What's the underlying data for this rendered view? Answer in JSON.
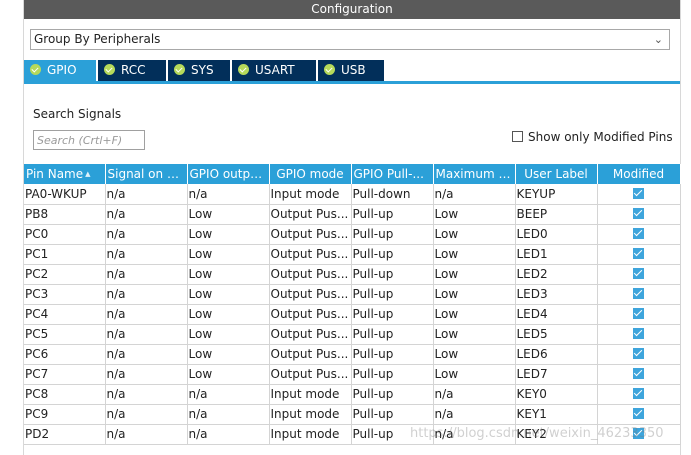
{
  "window": {
    "title": "Configuration"
  },
  "grouping": {
    "selected": "Group By Peripherals"
  },
  "tabs": [
    {
      "label": "GPIO",
      "icon": "ok-check-icon",
      "active": true
    },
    {
      "label": "RCC",
      "icon": "ok-check-icon",
      "active": false
    },
    {
      "label": "SYS",
      "icon": "ok-check-icon",
      "active": false
    },
    {
      "label": "USART",
      "icon": "ok-check-icon",
      "active": false
    },
    {
      "label": "USB",
      "icon": "ok-check-icon",
      "active": false
    }
  ],
  "search": {
    "label": "Search Signals",
    "placeholder": "Search (Crtl+F)",
    "value": ""
  },
  "filter": {
    "label": "Show only Modified Pins",
    "checked": false
  },
  "table": {
    "columns": [
      "Pin Name",
      "Signal on Pin",
      "GPIO outpu...",
      "GPIO mode",
      "GPIO Pull-...",
      "Maximum o...",
      "User Label",
      "Modified"
    ],
    "rows": [
      {
        "pin": "PA0-WKUP",
        "signal": "n/a",
        "output": "n/a",
        "mode": "Input mode",
        "pull": "Pull-down",
        "speed": "n/a",
        "label": "KEYUP",
        "modified": true
      },
      {
        "pin": "PB8",
        "signal": "n/a",
        "output": "Low",
        "mode": "Output Pus...",
        "pull": "Pull-up",
        "speed": "Low",
        "label": "BEEP",
        "modified": true
      },
      {
        "pin": "PC0",
        "signal": "n/a",
        "output": "Low",
        "mode": "Output Pus...",
        "pull": "Pull-up",
        "speed": "Low",
        "label": "LED0",
        "modified": true
      },
      {
        "pin": "PC1",
        "signal": "n/a",
        "output": "Low",
        "mode": "Output Pus...",
        "pull": "Pull-up",
        "speed": "Low",
        "label": "LED1",
        "modified": true
      },
      {
        "pin": "PC2",
        "signal": "n/a",
        "output": "Low",
        "mode": "Output Pus...",
        "pull": "Pull-up",
        "speed": "Low",
        "label": "LED2",
        "modified": true
      },
      {
        "pin": "PC3",
        "signal": "n/a",
        "output": "Low",
        "mode": "Output Pus...",
        "pull": "Pull-up",
        "speed": "Low",
        "label": "LED3",
        "modified": true
      },
      {
        "pin": "PC4",
        "signal": "n/a",
        "output": "Low",
        "mode": "Output Pus...",
        "pull": "Pull-up",
        "speed": "Low",
        "label": "LED4",
        "modified": true
      },
      {
        "pin": "PC5",
        "signal": "n/a",
        "output": "Low",
        "mode": "Output Pus...",
        "pull": "Pull-up",
        "speed": "Low",
        "label": "LED5",
        "modified": true
      },
      {
        "pin": "PC6",
        "signal": "n/a",
        "output": "Low",
        "mode": "Output Pus...",
        "pull": "Pull-up",
        "speed": "Low",
        "label": "LED6",
        "modified": true
      },
      {
        "pin": "PC7",
        "signal": "n/a",
        "output": "Low",
        "mode": "Output Pus...",
        "pull": "Pull-up",
        "speed": "Low",
        "label": "LED7",
        "modified": true
      },
      {
        "pin": "PC8",
        "signal": "n/a",
        "output": "n/a",
        "mode": "Input mode",
        "pull": "Pull-up",
        "speed": "n/a",
        "label": "KEY0",
        "modified": true
      },
      {
        "pin": "PC9",
        "signal": "n/a",
        "output": "n/a",
        "mode": "Input mode",
        "pull": "Pull-up",
        "speed": "n/a",
        "label": "KEY1",
        "modified": true
      },
      {
        "pin": "PD2",
        "signal": "n/a",
        "output": "n/a",
        "mode": "Input mode",
        "pull": "Pull-up",
        "speed": "n/a",
        "label": "KEY2",
        "modified": true
      }
    ]
  },
  "watermark": "https://blog.csdn.net/weixin_46233350",
  "colors": {
    "accent": "#2ba0d8",
    "tab_inactive": "#022f5a",
    "titlebar": "#5a5a5a",
    "ok_badge": "#b5d95a"
  }
}
